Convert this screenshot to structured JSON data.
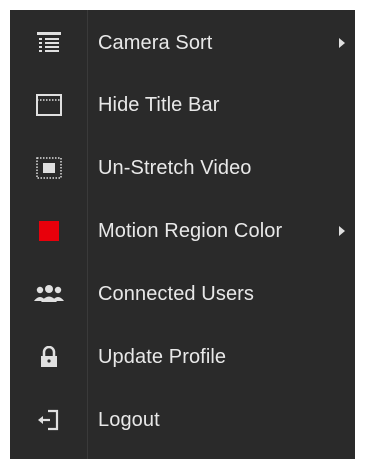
{
  "menu": {
    "items": [
      {
        "label": "Camera Sort",
        "icon": "list-icon",
        "submenu": true
      },
      {
        "label": "Hide Title Bar",
        "icon": "window-frame-icon",
        "submenu": false
      },
      {
        "label": "Un-Stretch Video",
        "icon": "unstretch-icon",
        "submenu": false
      },
      {
        "label": "Motion Region Color",
        "icon": "color-swatch-icon",
        "submenu": true
      },
      {
        "label": "Connected Users",
        "icon": "users-icon",
        "submenu": false
      },
      {
        "label": "Update Profile",
        "icon": "lock-icon",
        "submenu": false
      },
      {
        "label": "Logout",
        "icon": "logout-icon",
        "submenu": false
      }
    ]
  },
  "colors": {
    "background": "#2a2a2a",
    "text": "#e8e8e8",
    "icon": "#e0e0e0",
    "motion_region_swatch": "#e8000b"
  }
}
